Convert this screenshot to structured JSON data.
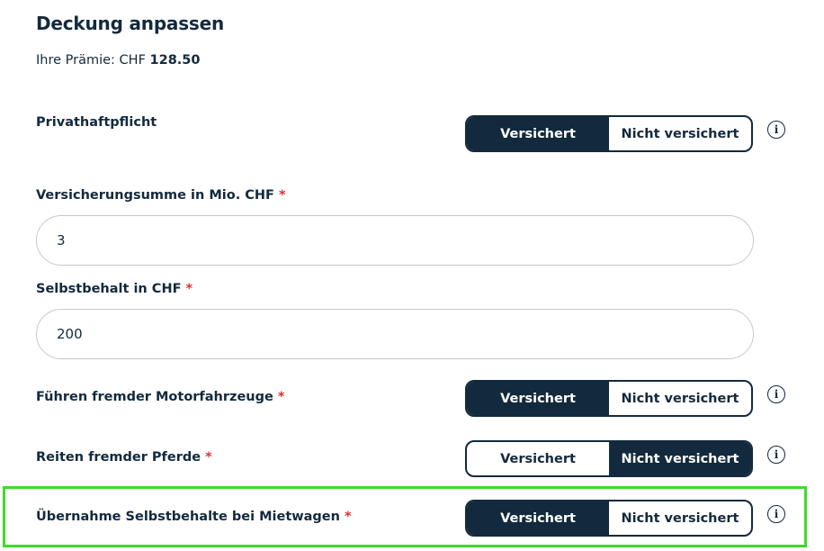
{
  "page": {
    "title": "Deckung anpassen",
    "premium_label": "Ihre Prämie: CHF",
    "premium_value": "128.50"
  },
  "required_marker": "*",
  "info_glyph": "i",
  "rows": {
    "privathaftpflicht": {
      "label": "Privathaftpflicht",
      "options": [
        "Versichert",
        "Nicht versichert"
      ],
      "selected": "Versichert"
    },
    "versicherungssumme": {
      "label": "Versicherungsumme in Mio. CHF",
      "value": "3"
    },
    "selbstbehalt": {
      "label": "Selbstbehalt in CHF",
      "value": "200"
    },
    "motorfahrzeuge": {
      "label": "Führen fremder Motorfahrzeuge",
      "options": [
        "Versichert",
        "Nicht versichert"
      ],
      "selected": "Versichert"
    },
    "pferde": {
      "label": "Reiten fremder Pferde",
      "options": [
        "Versichert",
        "Nicht versichert"
      ],
      "selected": "Nicht versichert"
    },
    "mietwagen": {
      "label": "Übernahme Selbstbehalte bei Mietwagen",
      "options": [
        "Versichert",
        "Nicht versichert"
      ],
      "selected": "Versichert"
    }
  },
  "colors": {
    "primary": "#13293d",
    "required": "#e0312e",
    "highlight": "#3ddc28",
    "field_border": "#c9c9c9"
  }
}
